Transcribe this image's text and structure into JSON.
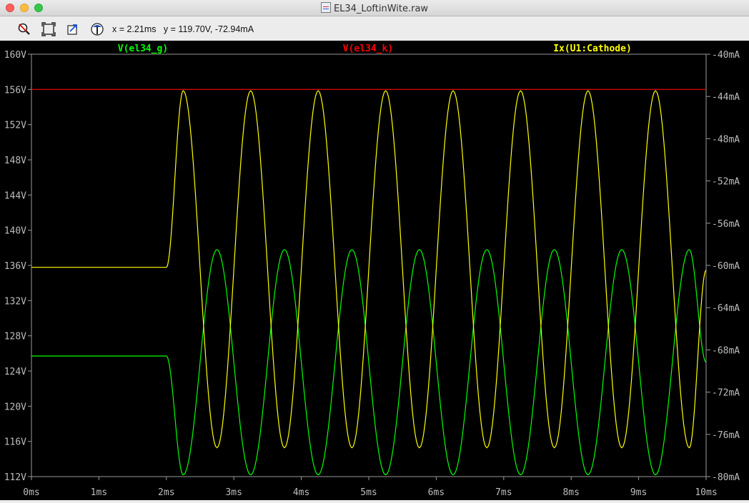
{
  "window": {
    "title": "EL34_LoftinWite.raw"
  },
  "toolbar": {
    "buttons": [
      {
        "name": "zoom-out-button",
        "icon": "magnifier-zoom-out-icon"
      },
      {
        "name": "zoom-fit-button",
        "icon": "zoom-fit-icon"
      },
      {
        "name": "undo-zoom-button",
        "icon": "undo-zoom-icon"
      },
      {
        "name": "probe-button",
        "icon": "current-probe-icon"
      }
    ],
    "cursor_x": "x = 2.21ms",
    "cursor_y": "y = 119.70V, -72.94mA"
  },
  "chart_data": {
    "type": "line",
    "background": "#000000",
    "xlabel": "",
    "ylabel": "",
    "y2label": "",
    "xlim": [
      0,
      10
    ],
    "ylim": [
      112,
      160
    ],
    "y2lim": [
      -80,
      -36
    ],
    "x_ticks": [
      "0ms",
      "1ms",
      "2ms",
      "3ms",
      "4ms",
      "5ms",
      "6ms",
      "7ms",
      "8ms",
      "9ms",
      "10ms"
    ],
    "y_ticks": [
      "112V",
      "116V",
      "120V",
      "124V",
      "128V",
      "132V",
      "136V",
      "140V",
      "144V",
      "148V",
      "152V",
      "156V",
      "160V"
    ],
    "y2_ticks": [
      "-80mA",
      "-76mA",
      "-72mA",
      "-68mA",
      "-64mA",
      "-60mA",
      "-56mA",
      "-52mA",
      "-48mA",
      "-44mA",
      "-40mA"
    ],
    "grid": false,
    "series": [
      {
        "name": "V(el34_g)",
        "color": "#00ff00",
        "axis": "left",
        "x": [
          0,
          2.0,
          2.25,
          2.75,
          3.25,
          3.75,
          4.25,
          4.75,
          5.25,
          5.75,
          6.25,
          6.75,
          7.25,
          7.75,
          8.25,
          8.75,
          9.25,
          9.75,
          10.0
        ],
        "y": [
          125.7,
          125.7,
          112.2,
          137.8,
          112.2,
          137.8,
          112.2,
          137.8,
          112.2,
          137.8,
          112.2,
          137.8,
          112.2,
          137.8,
          112.2,
          137.8,
          112.2,
          137.8,
          125.0
        ]
      },
      {
        "name": "V(el34_k)",
        "color": "#ff0000",
        "axis": "left",
        "x": [
          0,
          10
        ],
        "y": [
          156.0,
          156.0
        ]
      },
      {
        "name": "Ix(U1:Cathode)",
        "color": "#ffff00",
        "axis": "right",
        "x": [
          0,
          2.0,
          2.25,
          2.75,
          3.25,
          3.75,
          4.25,
          4.75,
          5.25,
          5.75,
          6.25,
          6.75,
          7.25,
          7.75,
          8.25,
          8.75,
          9.25,
          9.75,
          10.0
        ],
        "y": [
          -58.2,
          -58.2,
          -39.8,
          -77.0,
          -39.8,
          -77.0,
          -39.8,
          -77.0,
          -39.8,
          -77.0,
          -39.8,
          -77.0,
          -39.8,
          -77.0,
          -39.8,
          -77.0,
          -39.8,
          -77.0,
          -58.5
        ]
      }
    ]
  }
}
